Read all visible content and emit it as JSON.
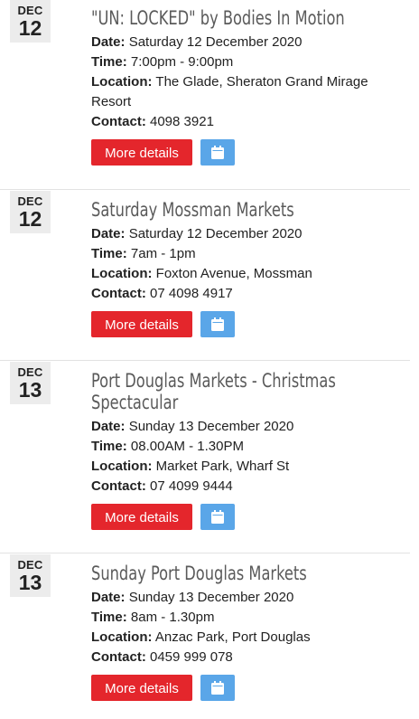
{
  "labels": {
    "date": "Date:",
    "time": "Time:",
    "location": "Location:",
    "contact": "Contact:",
    "more_details": "More details"
  },
  "icons": {
    "calendar": "calendar-icon"
  },
  "colors": {
    "more_button": "#e4262c",
    "calendar_button": "#5aa6e8",
    "date_badge_bg": "#ececec"
  },
  "events": [
    {
      "month": "DEC",
      "day": "12",
      "title": "\"UN: LOCKED\" by Bodies In Motion",
      "date": "Saturday 12 December 2020",
      "time": "7:00pm - 9:00pm",
      "location": "The Glade, Sheraton Grand Mirage Resort",
      "contact": "4098 3921"
    },
    {
      "month": "DEC",
      "day": "12",
      "title": "Saturday Mossman Markets",
      "date": "Saturday 12 December 2020",
      "time": "7am - 1pm",
      "location": "Foxton Avenue, Mossman",
      "contact": "07 4098 4917"
    },
    {
      "month": "DEC",
      "day": "13",
      "title": "Port Douglas Markets - Christmas Spectacular",
      "date": "Sunday 13 December 2020",
      "time": "08.00AM - 1.30PM",
      "location": "Market Park, Wharf St",
      "contact": "07 4099 9444"
    },
    {
      "month": "DEC",
      "day": "13",
      "title": "Sunday Port Douglas Markets",
      "date": "Sunday 13 December 2020",
      "time": "8am - 1.30pm",
      "location": "Anzac Park, Port Douglas",
      "contact": "0459 999 078"
    }
  ]
}
